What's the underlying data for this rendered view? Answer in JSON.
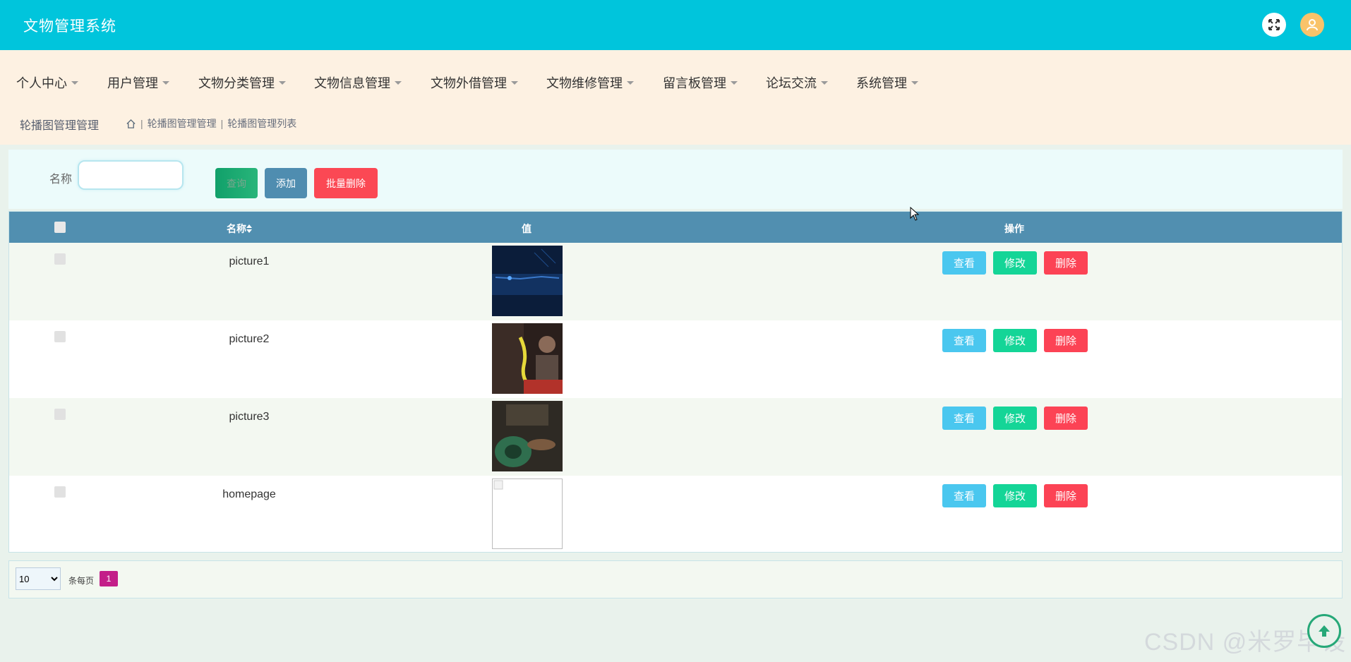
{
  "app": {
    "title": "文物管理系统"
  },
  "nav": [
    "个人中心",
    "用户管理",
    "文物分类管理",
    "文物信息管理",
    "文物外借管理",
    "文物维修管理",
    "留言板管理",
    "论坛交流",
    "系统管理"
  ],
  "breadcrumb": {
    "page_title": "轮播图管理管理",
    "path": [
      "轮播图管理管理",
      "轮播图管理列表"
    ]
  },
  "search": {
    "label": "名称",
    "value": "",
    "query_label": "查询",
    "add_label": "添加",
    "batch_delete_label": "批量删除"
  },
  "table": {
    "columns": [
      "名称",
      "值",
      "操作"
    ],
    "sort_icon": "sort-icon",
    "rows": [
      {
        "name": "picture1",
        "thumb": "dark-blue-tech"
      },
      {
        "name": "picture2",
        "thumb": "calligraphy-person"
      },
      {
        "name": "picture3",
        "thumb": "pottery-wheel"
      },
      {
        "name": "homepage",
        "thumb": "broken-image"
      }
    ],
    "row_actions": {
      "view": "查看",
      "edit": "修改",
      "delete": "删除"
    }
  },
  "pager": {
    "page_size": "10",
    "per_page_label": "条每页",
    "current_page": "1"
  },
  "watermark": "CSDN @米罗毕设",
  "colors": {
    "header": "#00c5dc",
    "nav_bg": "#fdf1e2",
    "table_header": "#518fb0",
    "view_btn": "#4ac7ef",
    "edit_btn": "#14d597",
    "delete_btn": "#fc4355",
    "page_active": "#c31e89"
  }
}
